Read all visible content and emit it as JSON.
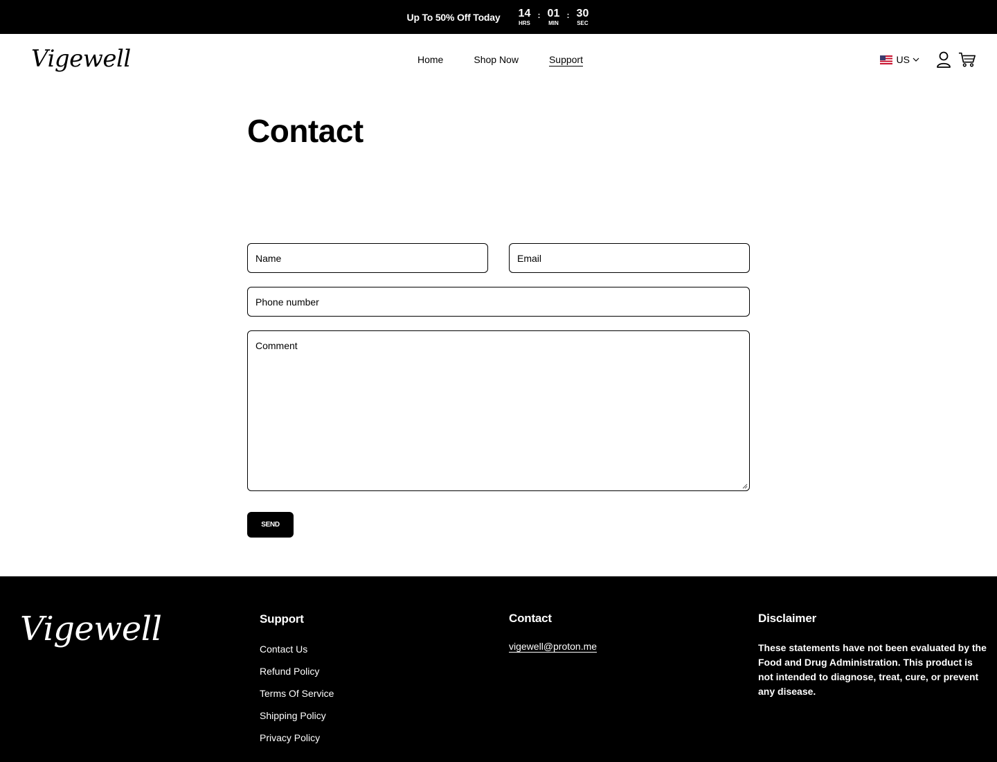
{
  "announcement": {
    "promo": "Up To 50% Off Today",
    "timer": [
      {
        "value": "14",
        "label": "HRS"
      },
      {
        "value": "01",
        "label": "MIN"
      },
      {
        "value": "30",
        "label": "SEC"
      }
    ],
    "separator": ":"
  },
  "header": {
    "logo": "Vigewell",
    "nav": [
      {
        "label": "Home"
      },
      {
        "label": "Shop Now"
      },
      {
        "label": "Support",
        "active": true
      }
    ],
    "locale": "US"
  },
  "main": {
    "title": "Contact",
    "form": {
      "name_placeholder": "Name",
      "email_placeholder": "Email",
      "phone_placeholder": "Phone number",
      "comment_placeholder": "Comment",
      "send_label": "SEND"
    }
  },
  "footer": {
    "logo": "Vigewell",
    "support": {
      "heading": "Support",
      "links": [
        "Contact Us",
        "Refund Policy",
        "Terms Of Service",
        "Shipping Policy",
        "Privacy Policy"
      ]
    },
    "contact": {
      "heading": "Contact",
      "email": "vigewell@proton.me"
    },
    "disclaimer": {
      "heading": "Disclaimer",
      "text": "These statements have not been evaluated by the Food and Drug Administration. This product is not intended to diagnose, treat, cure, or prevent any disease."
    }
  },
  "colors": {
    "background": "#ffffff",
    "bar": "#000000",
    "text": "#000000",
    "inverse_text": "#ffffff"
  }
}
